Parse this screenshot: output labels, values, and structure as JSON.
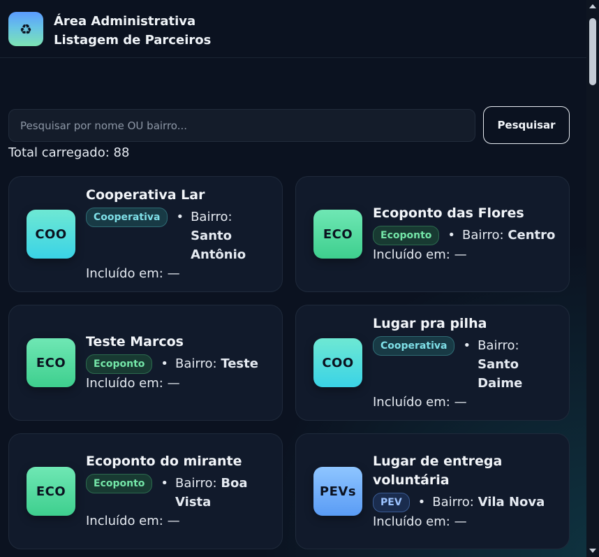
{
  "header": {
    "logo_icon": "recycle-icon",
    "logo_glyph": "♻",
    "title_line1": "Área Administrativa",
    "title_line2": "Listagem de Parceiros"
  },
  "search": {
    "placeholder": "Pesquisar por nome OU bairro...",
    "value": "",
    "button_label": "Pesquisar"
  },
  "total_label": "Total carregado: 88",
  "cards": [
    {
      "avatar": "COO",
      "type": "coo",
      "name": "Cooperativa Lar",
      "badge": "Cooperativa",
      "bairro_label": "Bairro:",
      "bairro": "Santo Antônio",
      "included": "Incluído em: —"
    },
    {
      "avatar": "ECO",
      "type": "eco",
      "name": "Ecoponto das Flores",
      "badge": "Ecoponto",
      "bairro_label": "Bairro:",
      "bairro": "Centro",
      "included": "Incluído em: —"
    },
    {
      "avatar": "ECO",
      "type": "eco",
      "name": "Teste Marcos",
      "badge": "Ecoponto",
      "bairro_label": "Bairro:",
      "bairro": "Teste",
      "included": "Incluído em: —"
    },
    {
      "avatar": "COO",
      "type": "coo",
      "name": "Lugar pra pilha",
      "badge": "Cooperativa",
      "bairro_label": "Bairro:",
      "bairro": "Santo Daime",
      "included": "Incluído em: —"
    },
    {
      "avatar": "ECO",
      "type": "eco",
      "name": "Ecoponto do mirante",
      "badge": "Ecoponto",
      "bairro_label": "Bairro:",
      "bairro": "Boa Vista",
      "included": "Incluído em: —"
    },
    {
      "avatar": "PEVs",
      "type": "pev",
      "name": "Lugar de entrega voluntária",
      "badge": "PEV",
      "bairro_label": "Bairro:",
      "bairro": "Vila Nova",
      "included": "Incluído em: —"
    }
  ],
  "colors": {
    "background": "#0b1220",
    "card": "#111a2b",
    "cooperativa": "#3ad3e6",
    "ecoponto": "#3ecf8e",
    "pev": "#5a9cf5"
  }
}
